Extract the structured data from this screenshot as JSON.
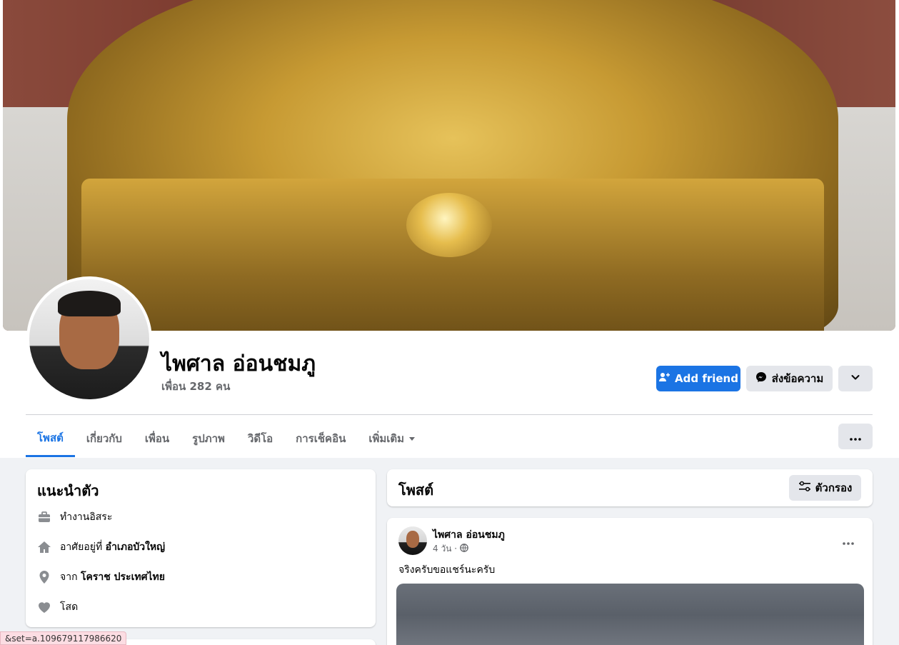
{
  "profile": {
    "name": "ไพศาล อ่อนชมภู",
    "friends_count": "เพื่อน 282 คน"
  },
  "actions": {
    "add_friend": "Add friend",
    "message": "ส่งข้อความ"
  },
  "tabs": [
    {
      "label": "โพสต์",
      "active": true
    },
    {
      "label": "เกี่ยวกับ"
    },
    {
      "label": "เพื่อน"
    },
    {
      "label": "รูปภาพ"
    },
    {
      "label": "วิดีโอ"
    },
    {
      "label": "การเช็คอิน"
    },
    {
      "label": "เพิ่มเติม"
    }
  ],
  "intro": {
    "title": "แนะนำตัว",
    "rows": [
      {
        "icon": "briefcase-icon",
        "text": "ทำงานอิสระ"
      },
      {
        "icon": "home-icon",
        "prefix": "อาศัยอยู่ที่ ",
        "bold": "อำเภอบัวใหญ่"
      },
      {
        "icon": "location-pin-icon",
        "prefix": "จาก ",
        "bold": "โคราช ประเทศไทย"
      },
      {
        "icon": "heart-icon",
        "text": "โสด"
      }
    ]
  },
  "posts": {
    "title": "โพสต์",
    "filter_label": "ตัวกรอง",
    "items": [
      {
        "author": "ไพศาล อ่อนชมภู",
        "time": "4 วัน ·",
        "text": "จริงครับขอแชร์นะครับ"
      }
    ]
  },
  "status_bar": {
    "url": "&set=a.109679117986620"
  },
  "colors": {
    "accent": "#1b74e4",
    "background": "#f0f2f5",
    "secondary_button": "#e4e6eb"
  }
}
